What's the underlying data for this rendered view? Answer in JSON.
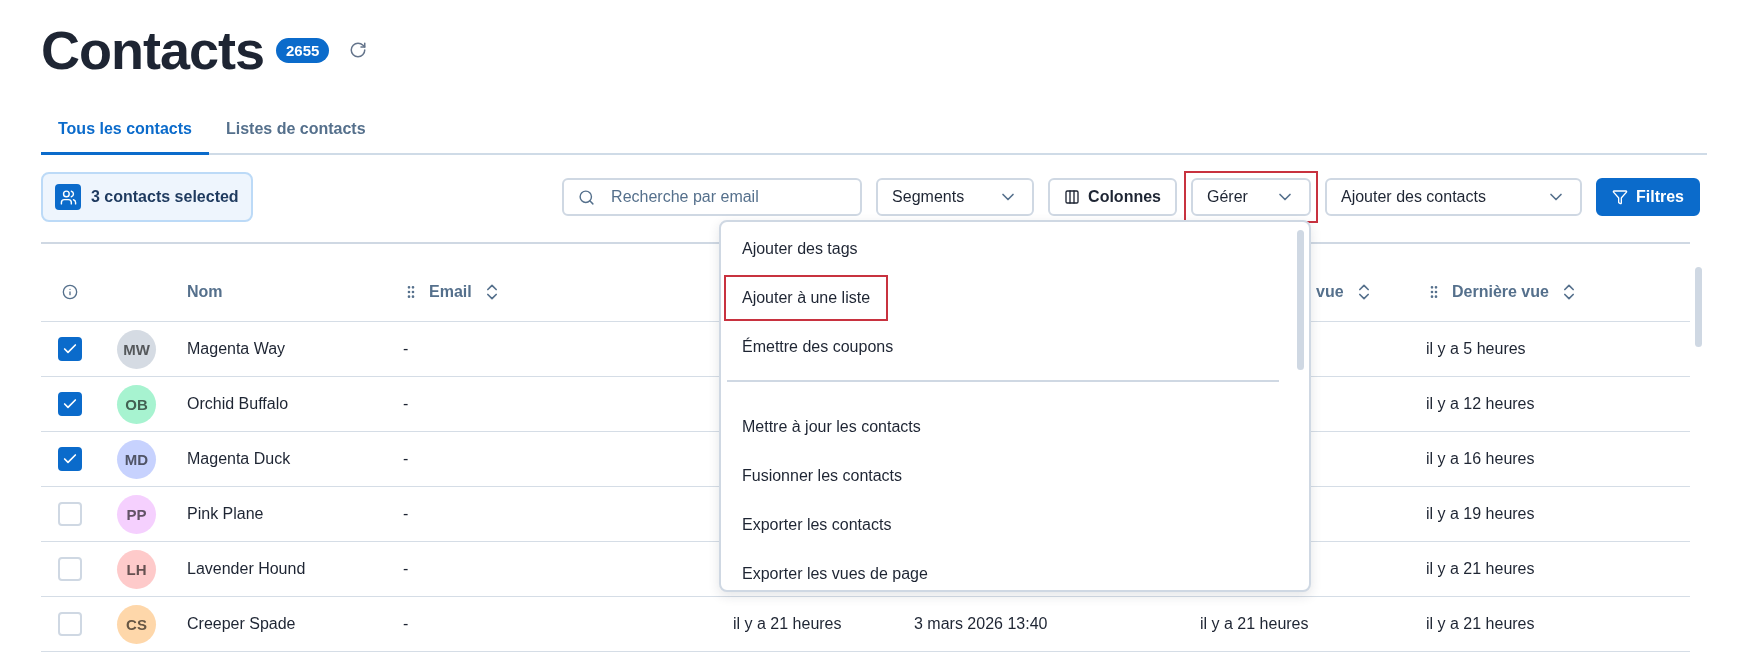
{
  "page": {
    "title": "Contacts",
    "count": "2655"
  },
  "tabs": [
    {
      "label": "Tous les contacts",
      "selected": true
    },
    {
      "label": "Listes de contacts",
      "selected": false
    }
  ],
  "selection": {
    "label": "3 contacts selected"
  },
  "toolbar": {
    "search": {
      "placeholder": "Recherche par email"
    },
    "buttons": [
      {
        "kind": "dropdown",
        "label": "Segments",
        "highlighted": false,
        "menu_open": false
      },
      {
        "kind": "columns",
        "label": "Colonnes",
        "highlighted": false,
        "menu_open": false
      },
      {
        "kind": "dropdown",
        "label": "Gérer",
        "highlighted": true,
        "menu_open": true
      },
      {
        "kind": "dropdown",
        "label": "Ajouter des contacts",
        "highlighted": false,
        "menu_open": false
      },
      {
        "kind": "primary",
        "label": "Filtres",
        "highlighted": false,
        "menu_open": false
      }
    ]
  },
  "menu": {
    "items": [
      {
        "kind": "item",
        "label": "Ajouter des tags",
        "highlighted": false
      },
      {
        "kind": "item",
        "label": "Ajouter à une liste",
        "highlighted": true
      },
      {
        "kind": "item",
        "label": "Émettre des coupons",
        "highlighted": false
      },
      {
        "kind": "divider"
      },
      {
        "kind": "item",
        "label": "Mettre à jour les contacts",
        "highlighted": false
      },
      {
        "kind": "item",
        "label": "Fusionner les contacts",
        "highlighted": false
      },
      {
        "kind": "item",
        "label": "Exporter les contacts",
        "highlighted": false
      },
      {
        "kind": "item",
        "label": "Exporter les vues de page",
        "highlighted": false
      }
    ]
  },
  "table": {
    "columns": [
      {
        "kind": "info"
      },
      {
        "kind": "avatar"
      },
      {
        "kind": "plain",
        "label": "Nom"
      },
      {
        "kind": "sortable",
        "label": "Email"
      },
      {
        "kind": "blank"
      },
      {
        "kind": "blank"
      },
      {
        "kind": "sortable",
        "label": "vue",
        "partial": true
      },
      {
        "kind": "sortable",
        "label": "Dernière vue"
      }
    ],
    "rows": [
      {
        "checked": true,
        "initials": "MW",
        "color": "#d5dbe3",
        "name": "Magenta Way",
        "cells": [
          "-",
          null,
          null,
          null,
          "il y a 5 heures"
        ]
      },
      {
        "checked": true,
        "initials": "OB",
        "color": "#a7f3d0",
        "name": "Orchid Buffalo",
        "cells": [
          "-",
          null,
          null,
          null,
          "il y a 12 heures"
        ]
      },
      {
        "checked": true,
        "initials": "MD",
        "color": "#c7d2fe",
        "name": "Magenta Duck",
        "cells": [
          "-",
          null,
          null,
          null,
          "il y a 16 heures"
        ]
      },
      {
        "checked": false,
        "initials": "PP",
        "color": "#f5d0fe",
        "name": "Pink Plane",
        "cells": [
          "-",
          null,
          null,
          null,
          "il y a 19 heures"
        ]
      },
      {
        "checked": false,
        "initials": "LH",
        "color": "#fecaca",
        "name": "Lavender Hound",
        "cells": [
          "-",
          null,
          null,
          null,
          "il y a 21 heures"
        ]
      },
      {
        "checked": false,
        "initials": "CS",
        "color": "#fed7aa",
        "name": "Creeper Spade",
        "cells": [
          "-",
          "il y a 21 heures",
          "3 mars 2026 13:40",
          "il y a 21 heures",
          "il y a 21 heures"
        ]
      }
    ]
  }
}
